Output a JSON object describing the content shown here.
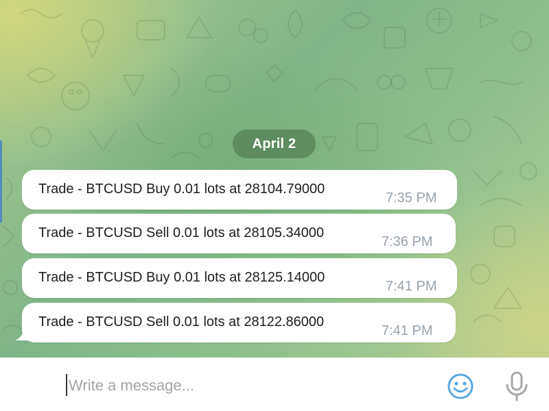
{
  "date_label": "April 2",
  "messages": [
    {
      "text": "Trade - BTCUSD Buy 0.01 lots at 28104.79000",
      "time": "7:35 PM"
    },
    {
      "text": "Trade - BTCUSD Sell 0.01 lots at 28105.34000",
      "time": "7:36 PM"
    },
    {
      "text": "Trade - BTCUSD Buy 0.01 lots at 28125.14000",
      "time": "7:41 PM"
    },
    {
      "text": "Trade - BTCUSD Sell 0.01 lots at 28122.86000",
      "time": "7:41 PM"
    }
  ],
  "composer": {
    "placeholder": "Write a message...",
    "value": ""
  },
  "icons": {
    "attach": "paperclip-icon",
    "emoji": "smiley-icon",
    "voice": "microphone-icon"
  },
  "colors": {
    "emoji_icon": "#5aa7e0",
    "icon_gray": "#a7a7a7",
    "date_pill": "#4a764e"
  }
}
